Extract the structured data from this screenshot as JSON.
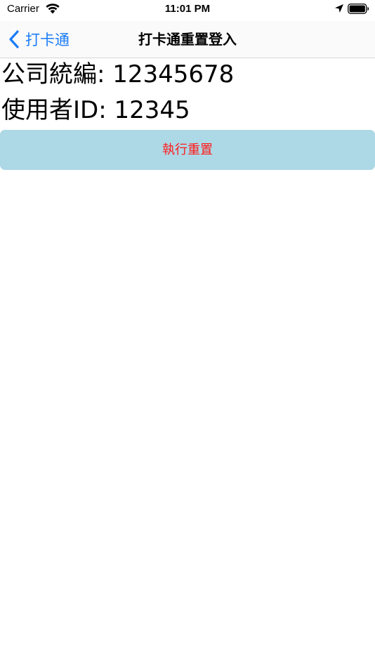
{
  "status_bar": {
    "carrier": "Carrier",
    "time": "11:01 PM",
    "icons": [
      "wifi-icon",
      "location-arrow-icon",
      "battery-icon"
    ]
  },
  "nav": {
    "back_label": "打卡通",
    "title": "打卡通重置登入",
    "back_icon": "chevron-left-icon",
    "accent_color": "#1a7cf5"
  },
  "content": {
    "company_id_line": "公司統編: 12345678",
    "user_id_line": "使用者ID: 12345"
  },
  "reset_button": {
    "label": "執行重置",
    "background_color": "#add8e6",
    "text_color": "#ff1a1a"
  }
}
